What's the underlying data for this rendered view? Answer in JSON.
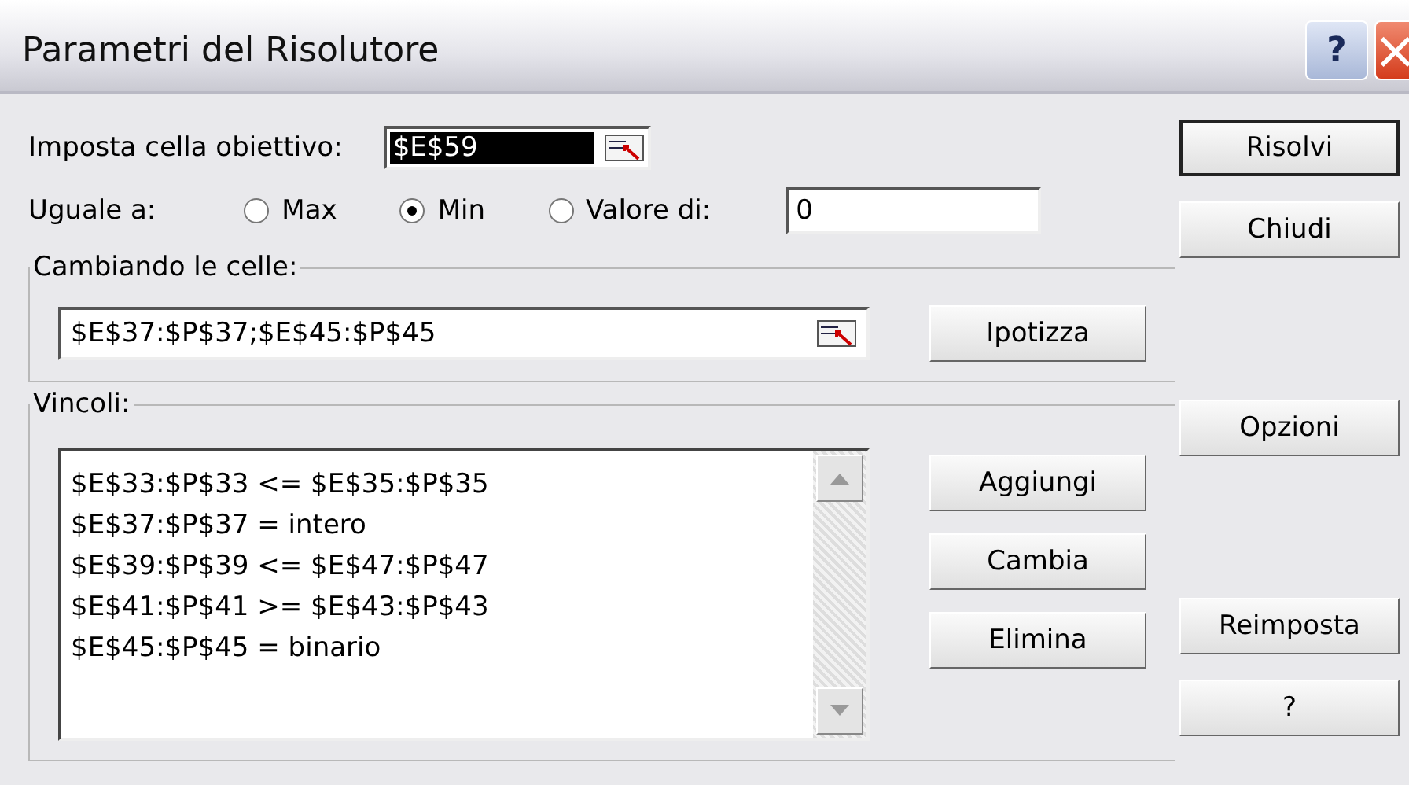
{
  "window": {
    "title": "Parametri del Risolutore",
    "help_button": "?"
  },
  "objective": {
    "label": "Imposta cella obiettivo:",
    "value": "$E$59",
    "highlighted": true
  },
  "equal_to": {
    "label": "Uguale a:",
    "options": [
      {
        "label": "Max",
        "selected": false
      },
      {
        "label": "Min",
        "selected": true
      },
      {
        "label": "Valore di:",
        "selected": false
      }
    ],
    "value": "0"
  },
  "changing_cells": {
    "legend": "Cambiando le celle:",
    "value": "$E$37:$P$37;$E$45:$P$45",
    "button": "Ipotizza"
  },
  "constraints": {
    "legend": "Vincoli:",
    "items": [
      "$E$33:$P$33 <= $E$35:$P$35",
      "$E$37:$P$37 = intero",
      "$E$39:$P$39 <= $E$47:$P$47",
      "$E$41:$P$41 >= $E$43:$P$43",
      "$E$45:$P$45 = binario"
    ],
    "buttons": [
      "Aggiungi",
      "Cambia",
      "Elimina"
    ]
  },
  "side_buttons": [
    {
      "label": "Risolvi",
      "default": true
    },
    {
      "label": "Chiudi",
      "default": false
    },
    {
      "label": "Opzioni",
      "default": false
    },
    {
      "label": "Reimposta",
      "default": false
    },
    {
      "label": "?",
      "default": false
    }
  ]
}
